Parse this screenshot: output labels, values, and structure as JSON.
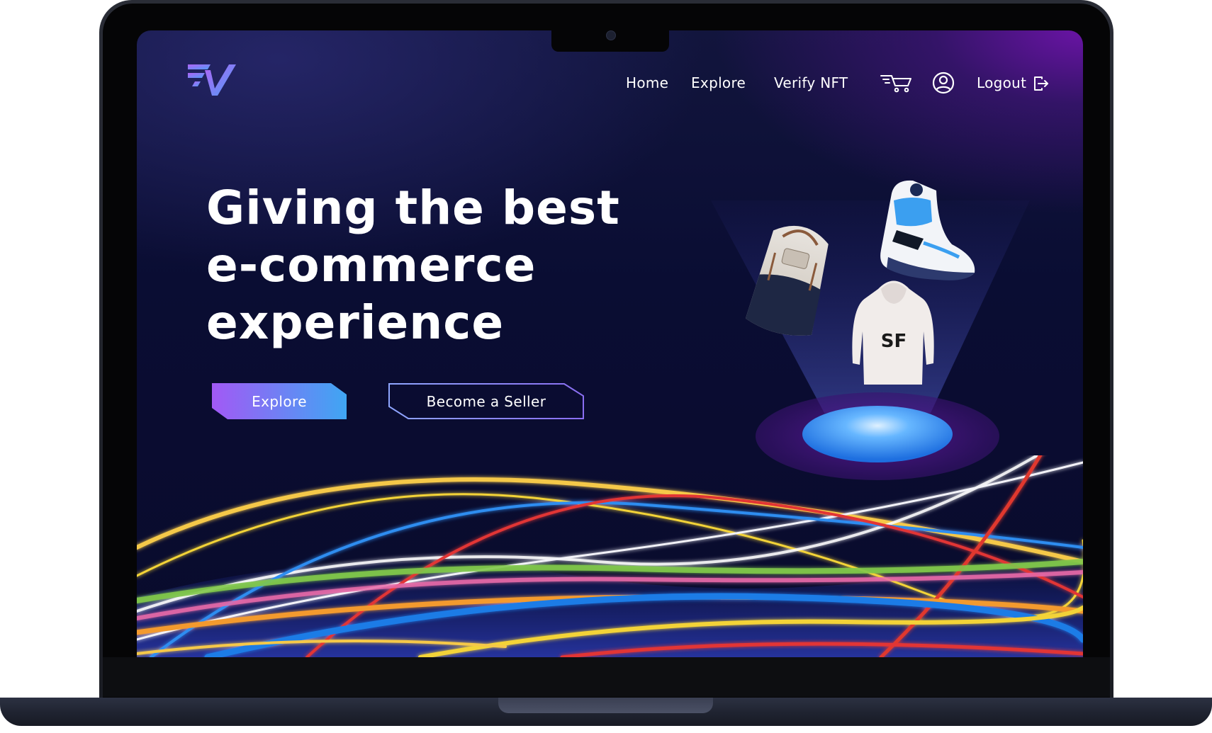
{
  "app": {
    "brand_logo": "FV monogram logo"
  },
  "nav": {
    "home": "Home",
    "explore": "Explore",
    "verify_nft": "Verify NFT",
    "cart_icon": "cart-icon",
    "profile_icon": "user-circle-icon",
    "logout": "Logout",
    "logout_icon": "logout-arrow-icon"
  },
  "hero": {
    "line1": "Giving the best",
    "line2": "e-commerce",
    "line3": "experience",
    "explore_button": "Explore",
    "seller_button": "Become a Seller"
  },
  "showcase": {
    "items": [
      "backpack",
      "sneaker",
      "hoodie"
    ],
    "hoodie_text": "SF"
  },
  "colors": {
    "background": "#0a0d33",
    "accent_purple": "#8f5cf7",
    "accent_blue": "#4aa0f5",
    "seller_border": "#7d8cf0",
    "text": "#ffffff"
  }
}
